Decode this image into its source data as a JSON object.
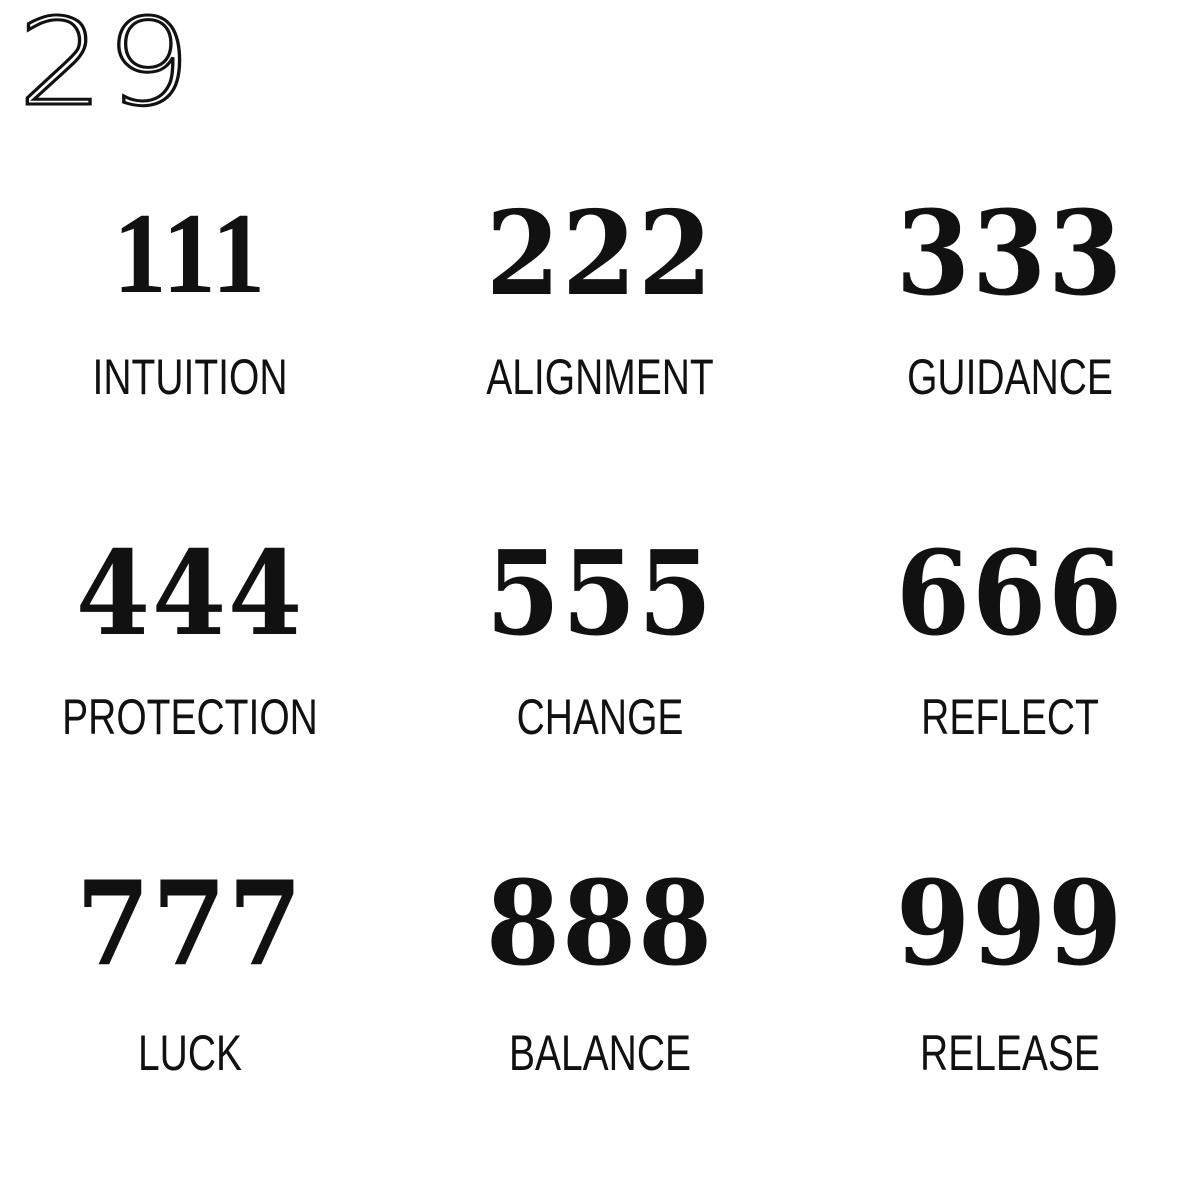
{
  "page_number": "29",
  "cells": [
    {
      "number": "111",
      "meaning": "INTUITION"
    },
    {
      "number": "222",
      "meaning": "ALIGNMENT"
    },
    {
      "number": "333",
      "meaning": "GUIDANCE"
    },
    {
      "number": "444",
      "meaning": "PROTECTION"
    },
    {
      "number": "555",
      "meaning": "CHANGE"
    },
    {
      "number": "666",
      "meaning": "REFLECT"
    },
    {
      "number": "777",
      "meaning": "LUCK"
    },
    {
      "number": "888",
      "meaning": "BALANCE"
    },
    {
      "number": "999",
      "meaning": "RELEASE"
    }
  ],
  "colors": {
    "text": "#111111",
    "background": "#ffffff"
  }
}
